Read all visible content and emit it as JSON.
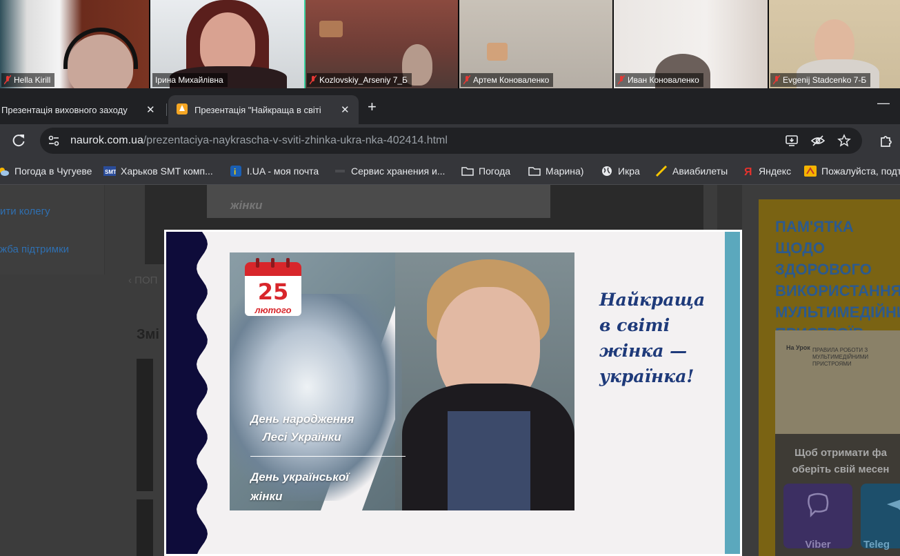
{
  "video_call": {
    "participants": [
      {
        "name": "Hella Kirill",
        "muted": true,
        "active": false
      },
      {
        "name": "Ірина Михайлівна",
        "muted": false,
        "active": true
      },
      {
        "name": "Kozlovskiy_Arseniy 7_Б",
        "muted": true,
        "active": false
      },
      {
        "name": "Артем Коноваленко",
        "muted": true,
        "active": false
      },
      {
        "name": "Иван Коноваленко",
        "muted": true,
        "active": false
      },
      {
        "name": "Evgenij Stadcenko 7-Б",
        "muted": true,
        "active": false
      }
    ]
  },
  "browser": {
    "tabs": [
      {
        "title": "Презентація виховного заходу",
        "active": false
      },
      {
        "title": "Презентація \"Найкраща в світі",
        "active": true
      }
    ],
    "new_tab": "+",
    "minimize": "—",
    "close_glyph": "✕",
    "url_host": "naurok.com.ua",
    "url_path": "/prezentaciya-naykrascha-v-sviti-zhinka-ukra-nka-402414.html",
    "bookmarks": [
      {
        "label": "Погода в Чугуеве",
        "icon": "weather-icon"
      },
      {
        "label": "Харьков SMT комп...",
        "icon": "smt-icon"
      },
      {
        "label": "I.UA - моя почта",
        "icon": "iua-icon"
      },
      {
        "label": "Сервис хранения и...",
        "icon": "storage-icon"
      },
      {
        "label": "Погода",
        "icon": "folder-icon"
      },
      {
        "label": "Марина)",
        "icon": "folder-icon"
      },
      {
        "label": "Икра",
        "icon": "globe-icon"
      },
      {
        "label": "Авиабилеты",
        "icon": "plane-icon"
      },
      {
        "label": "Яндекс",
        "icon": "yandex-icon"
      },
      {
        "label": "Пожалуйста, подт",
        "icon": "warning-icon"
      }
    ]
  },
  "page": {
    "sidebar_links": [
      "ити колегу",
      "жба підтримки"
    ],
    "prev_link": "‹ ПОП",
    "heading": "Змі",
    "thumb_text": "жінки",
    "ad": {
      "title": "ПАМ'ЯТКА ЩОДО ЗДОРОВОГО ВИКОРИСТАННЯ МУЛЬТИМЕДІЙНИХ ПРИСТРОЇВ",
      "card_logo": "На Урок",
      "card_text": "ПРАВИЛА РОБОТИ З МУЛЬТИМЕДІЙНИМИ ПРИСТРОЯМИ",
      "message": "Щоб отримати фа оберіть свій месен",
      "viber": "Viber",
      "telegram": "Teleg"
    }
  },
  "slide": {
    "calendar_day": "25",
    "calendar_month": "лютого",
    "caption_1a": "День народження",
    "caption_1b": "Лесі Українки",
    "caption_2a": "День української",
    "caption_2b": "жінки",
    "title_lines": [
      "Найкраща",
      "в світі",
      "жінка —",
      "українка!"
    ],
    "colors": {
      "title": "#1e3a7a",
      "wave": "#0e0c3a",
      "accent_bar": "#5ba8bd",
      "calendar": "#d8262b"
    }
  }
}
